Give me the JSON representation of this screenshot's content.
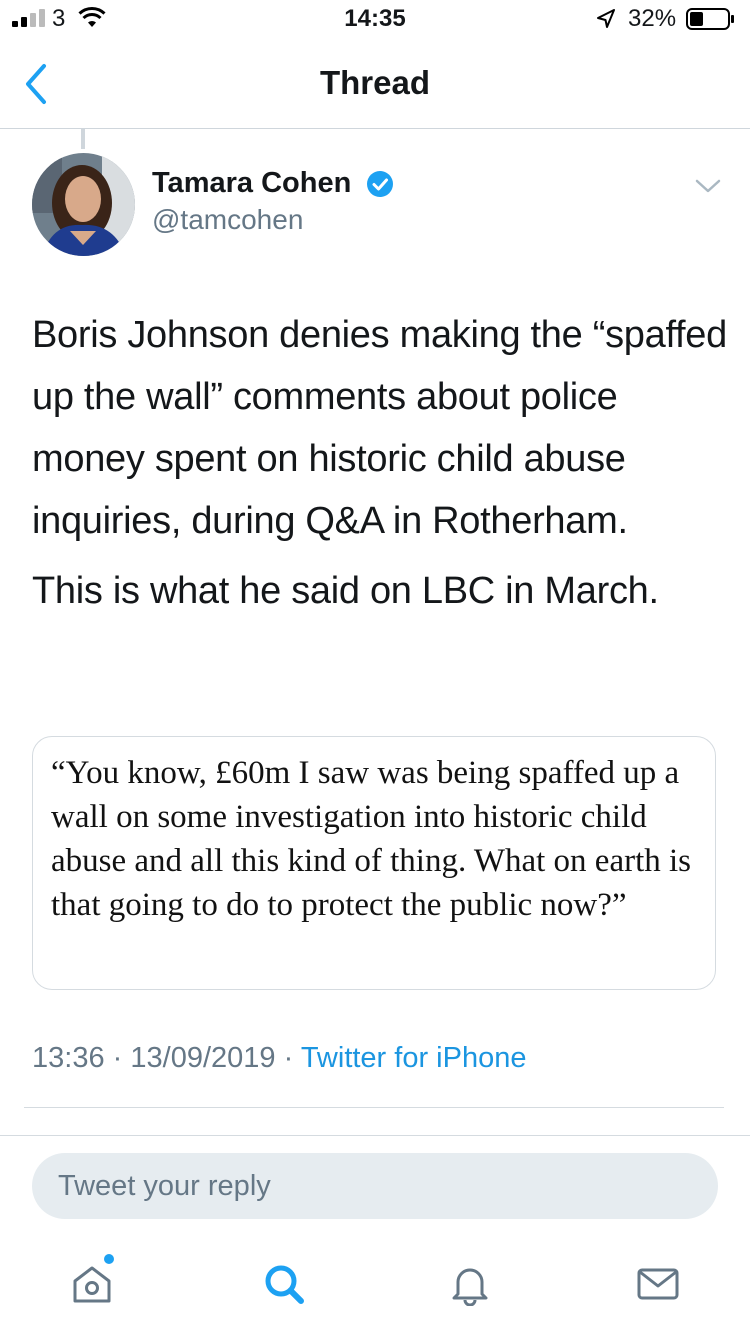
{
  "status_bar": {
    "carrier": "3",
    "time": "14:35",
    "battery_pct": "32%"
  },
  "nav": {
    "title": "Thread",
    "back_icon": "chevron-left-icon"
  },
  "tweet": {
    "author_name": "Tamara Cohen",
    "handle": "@tamcohen",
    "paragraphs": [
      "Boris Johnson denies making the “spaffed up the wall” comments about police money spent on historic child abuse inquiries, during Q&A in Rotherham.",
      "This is what he said on LBC in March."
    ],
    "quote": "“You know, £60m I saw was being spaffed up a wall on some investigation into historic child abuse and all this kind of thing. What on earth is that going to do to protect the public now?”",
    "time": "13:36",
    "date": "13/09/2019",
    "separator": "·",
    "source": "Twitter for iPhone"
  },
  "reply": {
    "placeholder": "Tweet your reply"
  },
  "tabbar": {
    "items": [
      {
        "icon": "home-icon",
        "active": false
      },
      {
        "icon": "search-icon",
        "active": true
      },
      {
        "icon": "bell-icon",
        "active": false
      },
      {
        "icon": "mail-icon",
        "active": false
      }
    ]
  },
  "colors": {
    "accent": "#1da1f2",
    "link": "#1b95e0",
    "muted": "#657786",
    "text": "#14171a",
    "reply_bg": "#e6ecf0"
  }
}
